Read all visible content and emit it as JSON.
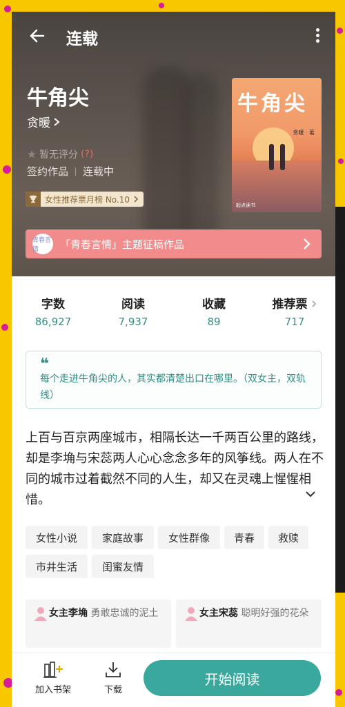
{
  "header": {
    "title": "连载"
  },
  "book": {
    "title": "牛角尖",
    "author": "贪暖",
    "rating_text": "暂无评分",
    "rating_hint": "(?)",
    "contract": "签约作品",
    "status": "连载中",
    "rank_badge": "女性推荐票月榜 No.10"
  },
  "cover": {
    "title": "牛角尖",
    "author": "贪暖 · 著",
    "publisher": "起点读书"
  },
  "banner": {
    "seal_text": "青春言情",
    "text": "「青春言情」主题征稿作品"
  },
  "stats": [
    {
      "label": "字数",
      "value": "86,927"
    },
    {
      "label": "阅读",
      "value": "7,937"
    },
    {
      "label": "收藏",
      "value": "89"
    },
    {
      "label": "推荐票",
      "value": "717"
    }
  ],
  "quote": {
    "text": "每个走进牛角尖的人，其实都清楚出口在哪里。（双女主，双轨线）"
  },
  "synopsis": "上百与百京两座城市，相隔长达一千两百公里的路线，却是李埆与宋蕊两人心心念念多年的风筝线。两人在不同的城市过着截然不同的人生，却又在灵魂上惺惺相惜。",
  "tags": [
    "女性小说",
    "家庭故事",
    "女性群像",
    "青春",
    "救赎",
    "市井生活",
    "闺蜜友情"
  ],
  "roles": [
    {
      "name": "女主李埆",
      "desc": "勇敢忠诚的泥土"
    },
    {
      "name": "女主宋蕊",
      "desc": "聪明好强的花朵"
    }
  ],
  "bottom": {
    "shelf": "加入书架",
    "download": "下载",
    "read": "开始阅读"
  },
  "colors": {
    "accent": "#3aa89c",
    "banner": "#f28b8b",
    "background": "#f7c800"
  }
}
